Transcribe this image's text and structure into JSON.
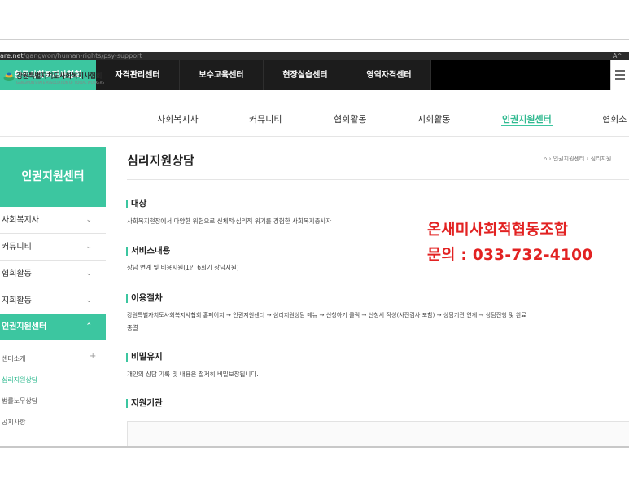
{
  "browser": {
    "url_host": "are.net",
    "url_path": "/gangwon/human-rights/psy-support",
    "reader_label": "A^"
  },
  "top_tabs": [
    {
      "label": "한국사회복지사협회"
    },
    {
      "label": "자격관리센터"
    },
    {
      "label": "보수교육센터"
    },
    {
      "label": "현장실습센터"
    },
    {
      "label": "영역자격센터"
    }
  ],
  "logo": {
    "title": "강원특별자치도사회복지사협회",
    "subtitle": "GANGWON STATE ASSOCIATION OF SOCIAL WORKERS"
  },
  "main_nav": [
    {
      "label": "사회복지사"
    },
    {
      "label": "커뮤니티"
    },
    {
      "label": "협회활동"
    },
    {
      "label": "지회활동"
    },
    {
      "label": "인권지원센터"
    },
    {
      "label": "협회소"
    }
  ],
  "sidebar": {
    "title": "인권지원센터",
    "items": [
      {
        "label": "사회복지사",
        "chevron": "⌄"
      },
      {
        "label": "커뮤니티",
        "chevron": "⌄"
      },
      {
        "label": "협회활동",
        "chevron": "⌄"
      },
      {
        "label": "지회활동",
        "chevron": "⌄"
      },
      {
        "label": "인권지원센터",
        "chevron": "⌃"
      }
    ],
    "sub_items": [
      {
        "label": "센터소개",
        "plus": "+"
      },
      {
        "label": "심리지원상담"
      },
      {
        "label": "법률노무상담"
      },
      {
        "label": "공지사항"
      }
    ]
  },
  "content": {
    "title": "심리지원상담",
    "breadcrumb": "⌂ › 인권지원센터 › 심리지원",
    "sections": [
      {
        "heading": "대상",
        "text": "사회복지현장에서 다양한 위험으로 신체적·심리적 위기를 경험한 사회복지종사자"
      },
      {
        "heading": "서비스내용",
        "text": "상담 연계 및 비용지원(1인 6회기 상담지원)"
      },
      {
        "heading": "이용절차",
        "text": "강원특별자치도사회복지사협회 홈페이지 → 인권지원센터 → 심리지원상담 메뉴 → 신청하기 클릭 → 신청서 작성(사전검사 포함) → 상담기관 연계 → 상담진행 및 완료",
        "text2": "종결"
      },
      {
        "heading": "비밀유지",
        "text": "개인의 상담 기록 및 내용은 철저히 비밀보장됩니다."
      },
      {
        "heading": "지원기관"
      }
    ]
  },
  "notice": {
    "line1": "온새미사회적협동조합",
    "line2": "문의 : 033-732-4100",
    "color": "#e22222"
  },
  "colors": {
    "accent": "#3cc6a0",
    "topbar": "#000000"
  }
}
